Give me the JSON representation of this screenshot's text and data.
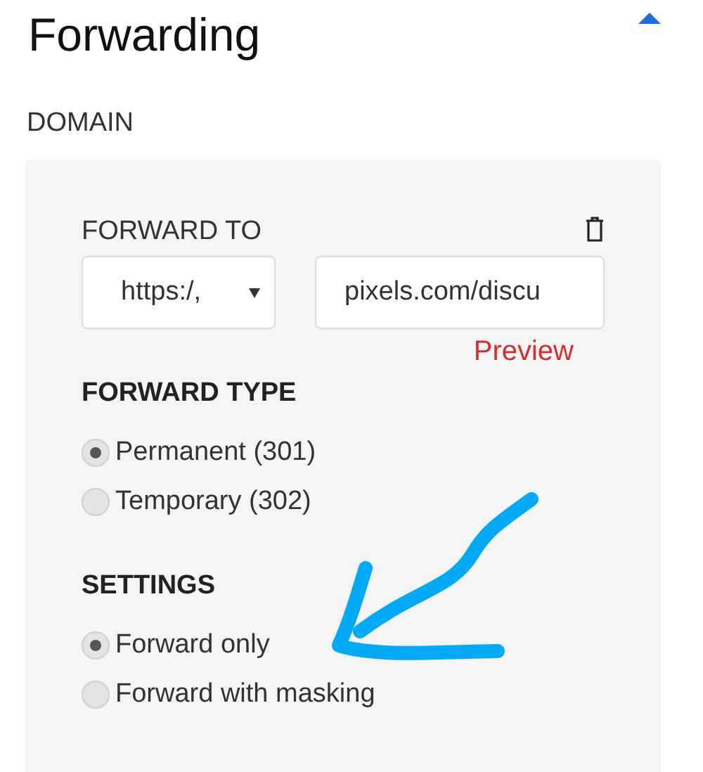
{
  "title": "Forwarding",
  "section": "DOMAIN",
  "forward_to": {
    "label": "FORWARD TO",
    "protocol": "https:/,",
    "url": "pixels.com/discu",
    "preview": "Preview"
  },
  "groups": [
    {
      "heading": "FORWARD TYPE",
      "options": [
        {
          "label": "Permanent (301)",
          "selected": true
        },
        {
          "label": "Temporary (302)",
          "selected": false
        }
      ]
    },
    {
      "heading": "SETTINGS",
      "options": [
        {
          "label": "Forward only",
          "selected": true
        },
        {
          "label": "Forward with masking",
          "selected": false
        }
      ]
    }
  ]
}
